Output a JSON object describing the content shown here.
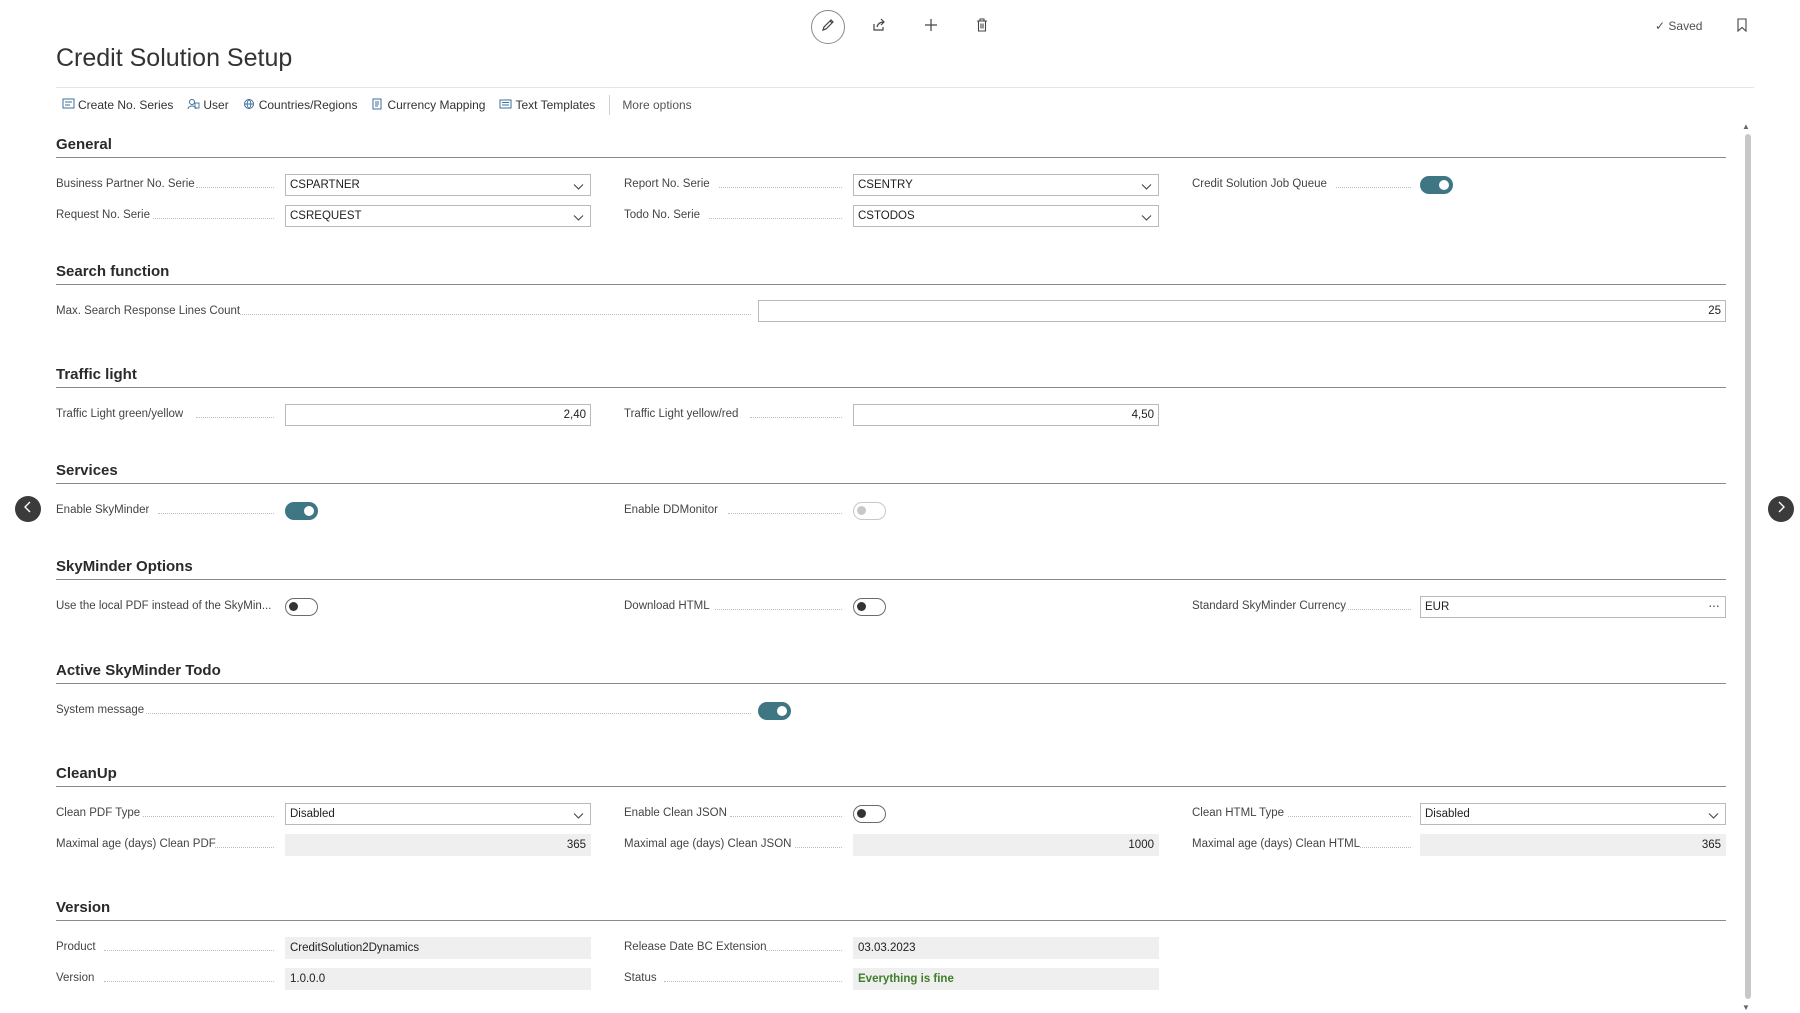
{
  "header": {
    "title": "Credit Solution Setup",
    "saved_label": "Saved"
  },
  "toolbar": {
    "actions": [
      {
        "label": "Create No. Series",
        "icon": "number-series-icon"
      },
      {
        "label": "User",
        "icon": "user-icon"
      },
      {
        "label": "Countries/Regions",
        "icon": "globe-icon"
      },
      {
        "label": "Currency Mapping",
        "icon": "currency-icon"
      },
      {
        "label": "Text Templates",
        "icon": "text-template-icon"
      }
    ],
    "more_options": "More options"
  },
  "sections": {
    "general": {
      "title": "General",
      "business_partner_label": "Business Partner No. Serie",
      "business_partner_value": "CSPARTNER",
      "request_label": "Request No. Serie",
      "request_value": "CSREQUEST",
      "report_label": "Report No. Serie",
      "report_value": "CSENTRY",
      "todo_label": "Todo No. Serie",
      "todo_value": "CSTODOS",
      "job_queue_label": "Credit Solution Job Queue",
      "job_queue_on": true
    },
    "search": {
      "title": "Search function",
      "max_lines_label": "Max. Search Response Lines Count",
      "max_lines_value": "25"
    },
    "traffic": {
      "title": "Traffic light",
      "green_yellow_label": "Traffic Light green/yellow",
      "green_yellow_value": "2,40",
      "yellow_red_label": "Traffic Light yellow/red",
      "yellow_red_value": "4,50"
    },
    "services": {
      "title": "Services",
      "skyminder_label": "Enable SkyMinder",
      "skyminder_on": true,
      "ddmonitor_label": "Enable DDMonitor",
      "ddmonitor_on": false
    },
    "skyminder_options": {
      "title": "SkyMinder Options",
      "local_pdf_label": "Use the local PDF instead of the SkyMin...",
      "local_pdf_on": false,
      "download_html_label": "Download HTML",
      "download_html_on": false,
      "currency_label": "Standard SkyMinder Currency",
      "currency_value": "EUR"
    },
    "todo": {
      "title": "Active SkyMinder Todo",
      "system_message_label": "System message",
      "system_message_on": true
    },
    "cleanup": {
      "title": "CleanUp",
      "pdf_type_label": "Clean PDF Type",
      "pdf_type_value": "Disabled",
      "pdf_age_label": "Maximal age (days) Clean PDF",
      "pdf_age_value": "365",
      "json_label": "Enable Clean JSON",
      "json_on": false,
      "json_age_label": "Maximal age (days) Clean JSON",
      "json_age_value": "1000",
      "html_type_label": "Clean HTML Type",
      "html_type_value": "Disabled",
      "html_age_label": "Maximal age (days) Clean HTML",
      "html_age_value": "365"
    },
    "version": {
      "title": "Version",
      "product_label": "Product",
      "product_value": "CreditSolution2Dynamics",
      "version_label": "Version",
      "version_value": "1.0.0.0",
      "release_label": "Release Date BC Extension",
      "release_value": "03.03.2023",
      "status_label": "Status",
      "status_value": "Everything is fine"
    }
  },
  "colors": {
    "toggle_on": "#3f7683",
    "status_ok": "#3f7e2b"
  }
}
